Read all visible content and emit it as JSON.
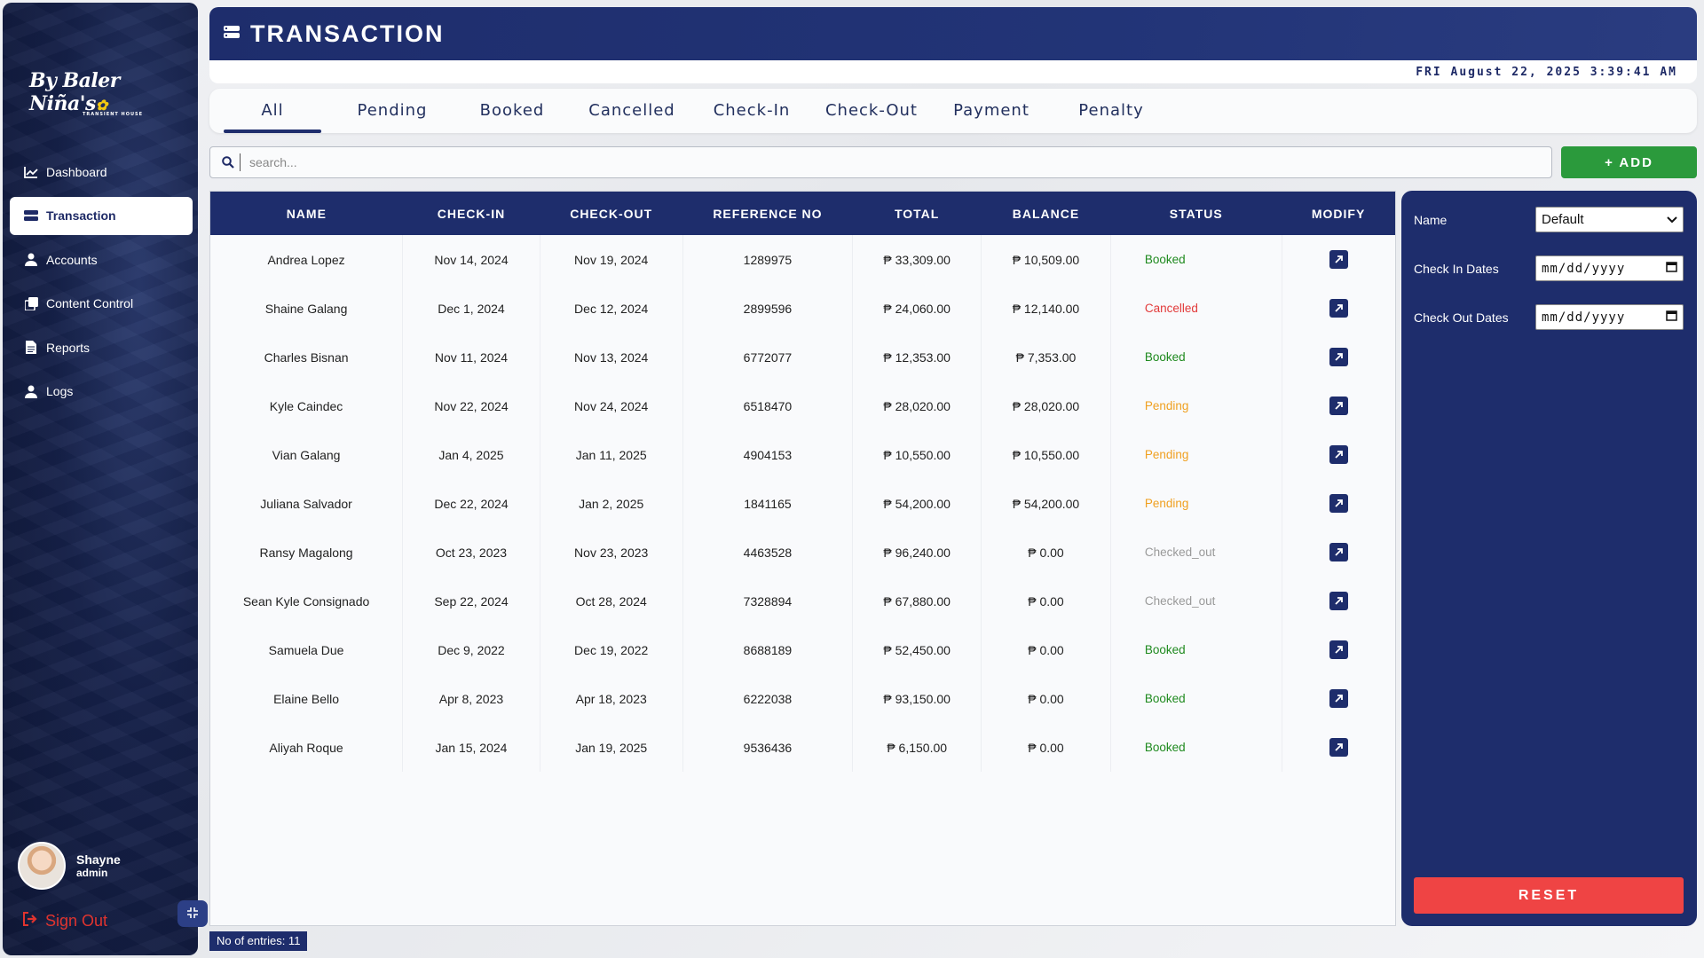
{
  "brand": {
    "name": "By Baler Niña's",
    "tagline": "TRANSIENT HOUSE"
  },
  "sidebar": {
    "items": [
      {
        "label": "Dashboard",
        "icon": "chart-line-icon",
        "active": false
      },
      {
        "label": "Transaction",
        "icon": "transaction-icon",
        "active": true
      },
      {
        "label": "Accounts",
        "icon": "user-icon",
        "active": false
      },
      {
        "label": "Content Control",
        "icon": "copy-icon",
        "active": false
      },
      {
        "label": "Reports",
        "icon": "document-icon",
        "active": false
      },
      {
        "label": "Logs",
        "icon": "user-icon",
        "active": false
      }
    ],
    "user": {
      "name": "Shayne",
      "role": "admin"
    },
    "signout_label": "Sign Out"
  },
  "header": {
    "title": "TRANSACTION",
    "datetime": "FRI August 22, 2025 3:39:41 AM"
  },
  "tabs": [
    "All",
    "Pending",
    "Booked",
    "Cancelled",
    "Check-In",
    "Check-Out",
    "Payment",
    "Penalty"
  ],
  "active_tab": "All",
  "search": {
    "placeholder": "search..."
  },
  "add_label": "+ ADD",
  "table": {
    "columns": [
      "NAME",
      "CHECK-IN",
      "CHECK-OUT",
      "REFERENCE NO",
      "TOTAL",
      "BALANCE",
      "STATUS",
      "MODIFY"
    ],
    "rows": [
      {
        "name": "Andrea Lopez",
        "checkin": "Nov 14, 2024",
        "checkout": "Nov 19, 2024",
        "ref": "1289975",
        "total": "₱ 33,309.00",
        "balance": "₱ 10,509.00",
        "status": "Booked"
      },
      {
        "name": "Shaine Galang",
        "checkin": "Dec 1, 2024",
        "checkout": "Dec 12, 2024",
        "ref": "2899596",
        "total": "₱ 24,060.00",
        "balance": "₱ 12,140.00",
        "status": "Cancelled"
      },
      {
        "name": "Charles Bisnan",
        "checkin": "Nov 11, 2024",
        "checkout": "Nov 13, 2024",
        "ref": "6772077",
        "total": "₱ 12,353.00",
        "balance": "₱ 7,353.00",
        "status": "Booked"
      },
      {
        "name": "Kyle Caindec",
        "checkin": "Nov 22, 2024",
        "checkout": "Nov 24, 2024",
        "ref": "6518470",
        "total": "₱ 28,020.00",
        "balance": "₱ 28,020.00",
        "status": "Pending"
      },
      {
        "name": "Vian Galang",
        "checkin": "Jan 4, 2025",
        "checkout": "Jan 11, 2025",
        "ref": "4904153",
        "total": "₱ 10,550.00",
        "balance": "₱ 10,550.00",
        "status": "Pending"
      },
      {
        "name": "Juliana Salvador",
        "checkin": "Dec 22, 2024",
        "checkout": "Jan 2, 2025",
        "ref": "1841165",
        "total": "₱ 54,200.00",
        "balance": "₱ 54,200.00",
        "status": "Pending"
      },
      {
        "name": "Ransy Magalong",
        "checkin": "Oct 23, 2023",
        "checkout": "Nov 23, 2023",
        "ref": "4463528",
        "total": "₱ 96,240.00",
        "balance": "₱ 0.00",
        "status": "Checked_out"
      },
      {
        "name": "Sean Kyle Consignado",
        "checkin": "Sep 22, 2024",
        "checkout": "Oct 28, 2024",
        "ref": "7328894",
        "total": "₱ 67,880.00",
        "balance": "₱ 0.00",
        "status": "Checked_out"
      },
      {
        "name": "Samuela Due",
        "checkin": "Dec 9, 2022",
        "checkout": "Dec 19, 2022",
        "ref": "8688189",
        "total": "₱ 52,450.00",
        "balance": "₱ 0.00",
        "status": "Booked"
      },
      {
        "name": "Elaine Bello",
        "checkin": "Apr 8, 2023",
        "checkout": "Apr 18, 2023",
        "ref": "6222038",
        "total": "₱ 93,150.00",
        "balance": "₱ 0.00",
        "status": "Booked"
      },
      {
        "name": "Aliyah Roque",
        "checkin": "Jan 15, 2024",
        "checkout": "Jan 19, 2025",
        "ref": "9536436",
        "total": "₱ 6,150.00",
        "balance": "₱ 0.00",
        "status": "Booked"
      }
    ]
  },
  "entries_label": "No of entries: 11",
  "filter": {
    "name_label": "Name",
    "name_value": "Default",
    "checkin_label": "Check In Dates",
    "checkout_label": "Check Out Dates",
    "date_placeholder": "mm/dd/yyyy",
    "reset_label": "RESET"
  },
  "colors": {
    "primary": "#1e2d6c",
    "add": "#2b9a3c",
    "reset": "#ef4444",
    "booked": "#1f8a1f",
    "cancelled": "#e23a3a",
    "pending": "#f0a020",
    "checked_out": "#999999"
  }
}
